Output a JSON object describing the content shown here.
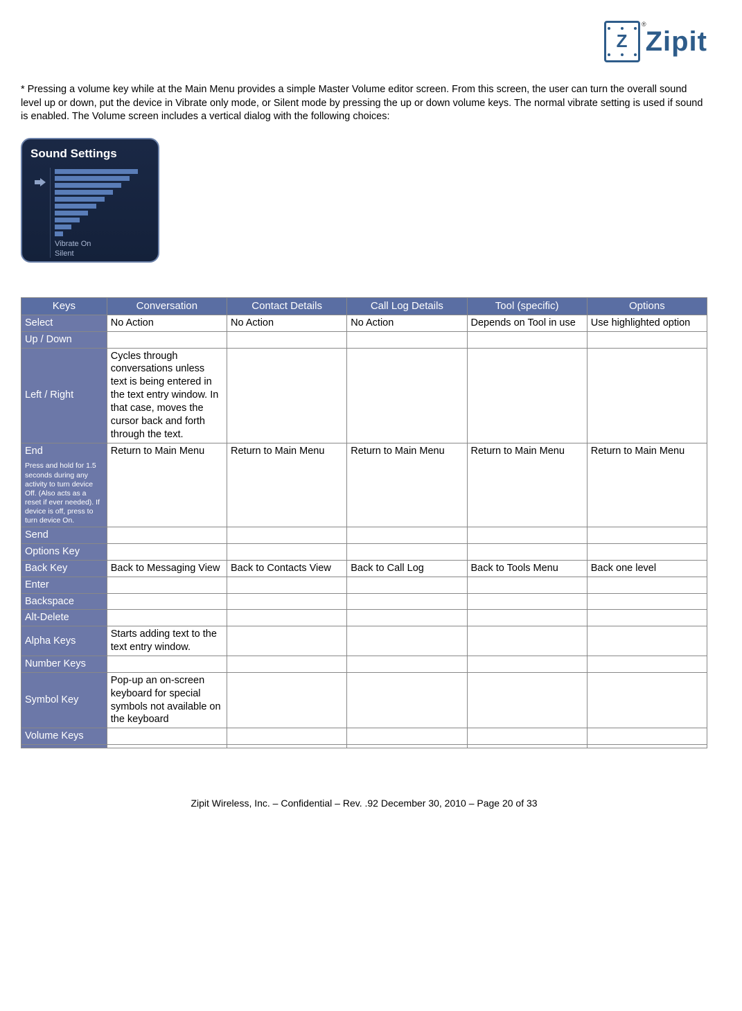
{
  "logo_text": "Zipit",
  "paragraph": "* Pressing a volume key while at the Main Menu provides a simple Master Volume editor screen.  From this screen, the user can turn the overall sound level up or down, put the device in Vibrate only mode, or Silent mode by pressing the up or down volume keys.  The normal vibrate setting is used if sound is enabled.  The Volume screen includes a vertical dialog with the following choices:",
  "sound_card": {
    "title": "Sound Settings",
    "label1": "Vibrate On",
    "label2": "Silent"
  },
  "table": {
    "headers": [
      "Keys",
      "Conversation",
      "Contact Details",
      "Call Log Details",
      "Tool (specific)",
      "Options"
    ],
    "rows": [
      {
        "key": "Select",
        "note": "",
        "cells": [
          "No Action",
          "No Action",
          "No Action",
          "Depends on Tool in use",
          "Use highlighted option"
        ]
      },
      {
        "key": "Up / Down",
        "note": "",
        "cells": [
          "",
          "",
          "",
          "",
          ""
        ]
      },
      {
        "key": "Left / Right",
        "note": "",
        "cells": [
          "Cycles through conversations unless text is being entered in the text entry window.  In that case, moves the cursor back and forth through the text.",
          "",
          "",
          "",
          ""
        ]
      },
      {
        "key": "End",
        "note": "Press and hold for 1.5 seconds during any activity to turn device Off.  (Also acts as a reset if ever needed).  If device is off, press to turn device On.",
        "cells": [
          "Return to Main Menu",
          "Return to Main Menu",
          "Return to Main Menu",
          "Return to Main Menu",
          "Return to Main Menu"
        ]
      },
      {
        "key": "Send",
        "note": "",
        "cells": [
          "",
          "",
          "",
          "",
          ""
        ]
      },
      {
        "key": "Options Key",
        "note": "",
        "cells": [
          "",
          "",
          "",
          "",
          ""
        ]
      },
      {
        "key": "Back Key",
        "note": "",
        "cells": [
          "Back to Messaging View",
          "Back to Contacts View",
          "Back to Call Log",
          "Back to Tools Menu",
          "Back one level"
        ]
      },
      {
        "key": "Enter",
        "note": "",
        "cells": [
          "",
          "",
          "",
          "",
          ""
        ]
      },
      {
        "key": "Backspace",
        "note": "",
        "cells": [
          "",
          "",
          "",
          "",
          ""
        ]
      },
      {
        "key": "Alt-Delete",
        "note": "",
        "cells": [
          "",
          "",
          "",
          "",
          ""
        ]
      },
      {
        "key": "Alpha Keys",
        "note": "",
        "cells": [
          "Starts adding text to the text entry window.",
          "",
          "",
          "",
          ""
        ]
      },
      {
        "key": "Number Keys",
        "note": "",
        "cells": [
          "",
          "",
          "",
          "",
          ""
        ]
      },
      {
        "key": "Symbol Key",
        "note": "",
        "cells": [
          "Pop-up an on-screen keyboard for special symbols not available on the keyboard",
          "",
          "",
          "",
          ""
        ]
      },
      {
        "key": "Volume Keys",
        "note": "",
        "cells": [
          "",
          "",
          "",
          "",
          ""
        ]
      },
      {
        "key": "",
        "note": "",
        "cells": [
          "",
          "",
          "",
          "",
          ""
        ]
      }
    ]
  },
  "footer": "Zipit Wireless, Inc. – Confidential – Rev. .92 December 30, 2010 – Page 20 of 33"
}
